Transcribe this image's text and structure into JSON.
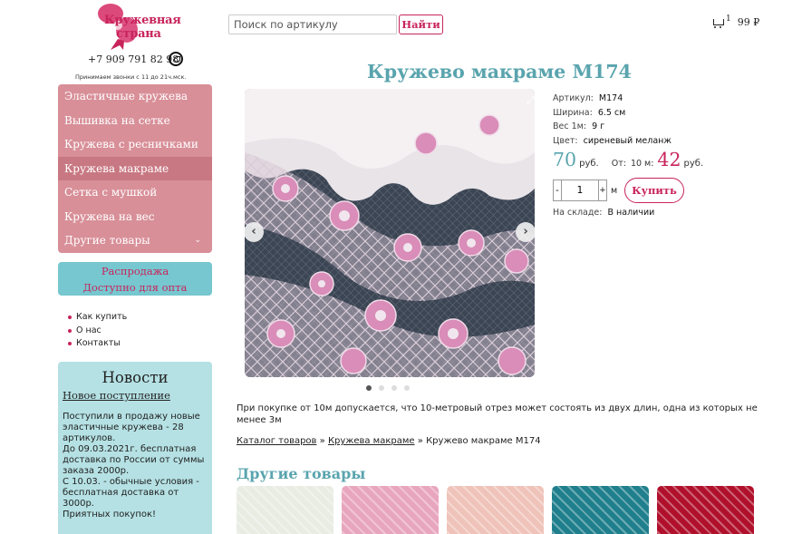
{
  "header": {
    "logo_line1": "Кружевная",
    "logo_line2": "страна",
    "phone": "+7 909 791 82 98",
    "call_hours": "Принимаем звонки с 11 до 21ч.мск.",
    "search_placeholder": "Поиск по артикулу",
    "search_button": "Найти",
    "cart_count": "1",
    "cart_total": "99 ₽"
  },
  "sidebar": {
    "menu": [
      "Эластичные кружева",
      "Вышивка на сетке",
      "Кружева с ресничками",
      "Кружева макраме",
      "Сетка с мушкой",
      "Кружева на вес",
      "Другие товары"
    ],
    "active_menu": "Кружева макраме",
    "sale_line1": "Распродажа",
    "sale_line2": "Доступно для опта",
    "links": [
      "Как купить",
      "О нас",
      "Контакты"
    ],
    "news": {
      "title": "Новости",
      "link": "Новое поступление",
      "body": "Поступили в продажу новые эластичные кружева - 28 артикулов.\nДо 09.03.2021г. бесплатная доставка по России от суммы заказа 2000р.\nС 10.03. - обычные условия - бесплатная доставка от 3000р.\nПриятных покупок!"
    }
  },
  "product": {
    "title": "Кружево макраме М174",
    "article_label": "Артикул:",
    "article": "М174",
    "width_label": "Ширина:",
    "width": "6.5 см",
    "weight_label": "Вес 1м:",
    "weight": "9 г",
    "color_label": "Цвет:",
    "color": "сиреневый меланж",
    "price": "70",
    "price_unit": "руб.",
    "wholesale_from": "От:",
    "wholesale_qty": "10 м:",
    "wholesale_price": "42",
    "wholesale_unit": "руб.",
    "qty_minus": "-",
    "qty_value": "1",
    "qty_plus": "+",
    "qty_unit": "м",
    "buy_button": "Купить",
    "stock_label": "На складе:",
    "stock": "В наличии",
    "slide_count": 4,
    "active_slide": 1,
    "note": "При покупке от 10м допускается, что 10-метровый отрез может состоять из двух длин, одна из которых не менее 3м"
  },
  "breadcrumb": {
    "catalog": "Каталог товаров",
    "sep1": "»",
    "category": "Кружева макраме",
    "sep2": "»",
    "current": "Кружево макраме М174"
  },
  "other": {
    "title": "Другие товары",
    "thumbs": [
      "#e9ece3",
      "#e8a6be",
      "#efc3b9",
      "#1f7f8c",
      "#b0102b"
    ]
  },
  "colors": {
    "brand_pink": "#c8245c",
    "menu_bg": "#d88f98",
    "teal": "#5aa4ae",
    "sale_bg": "#76c7cf",
    "news_bg": "#b5e1e4"
  }
}
